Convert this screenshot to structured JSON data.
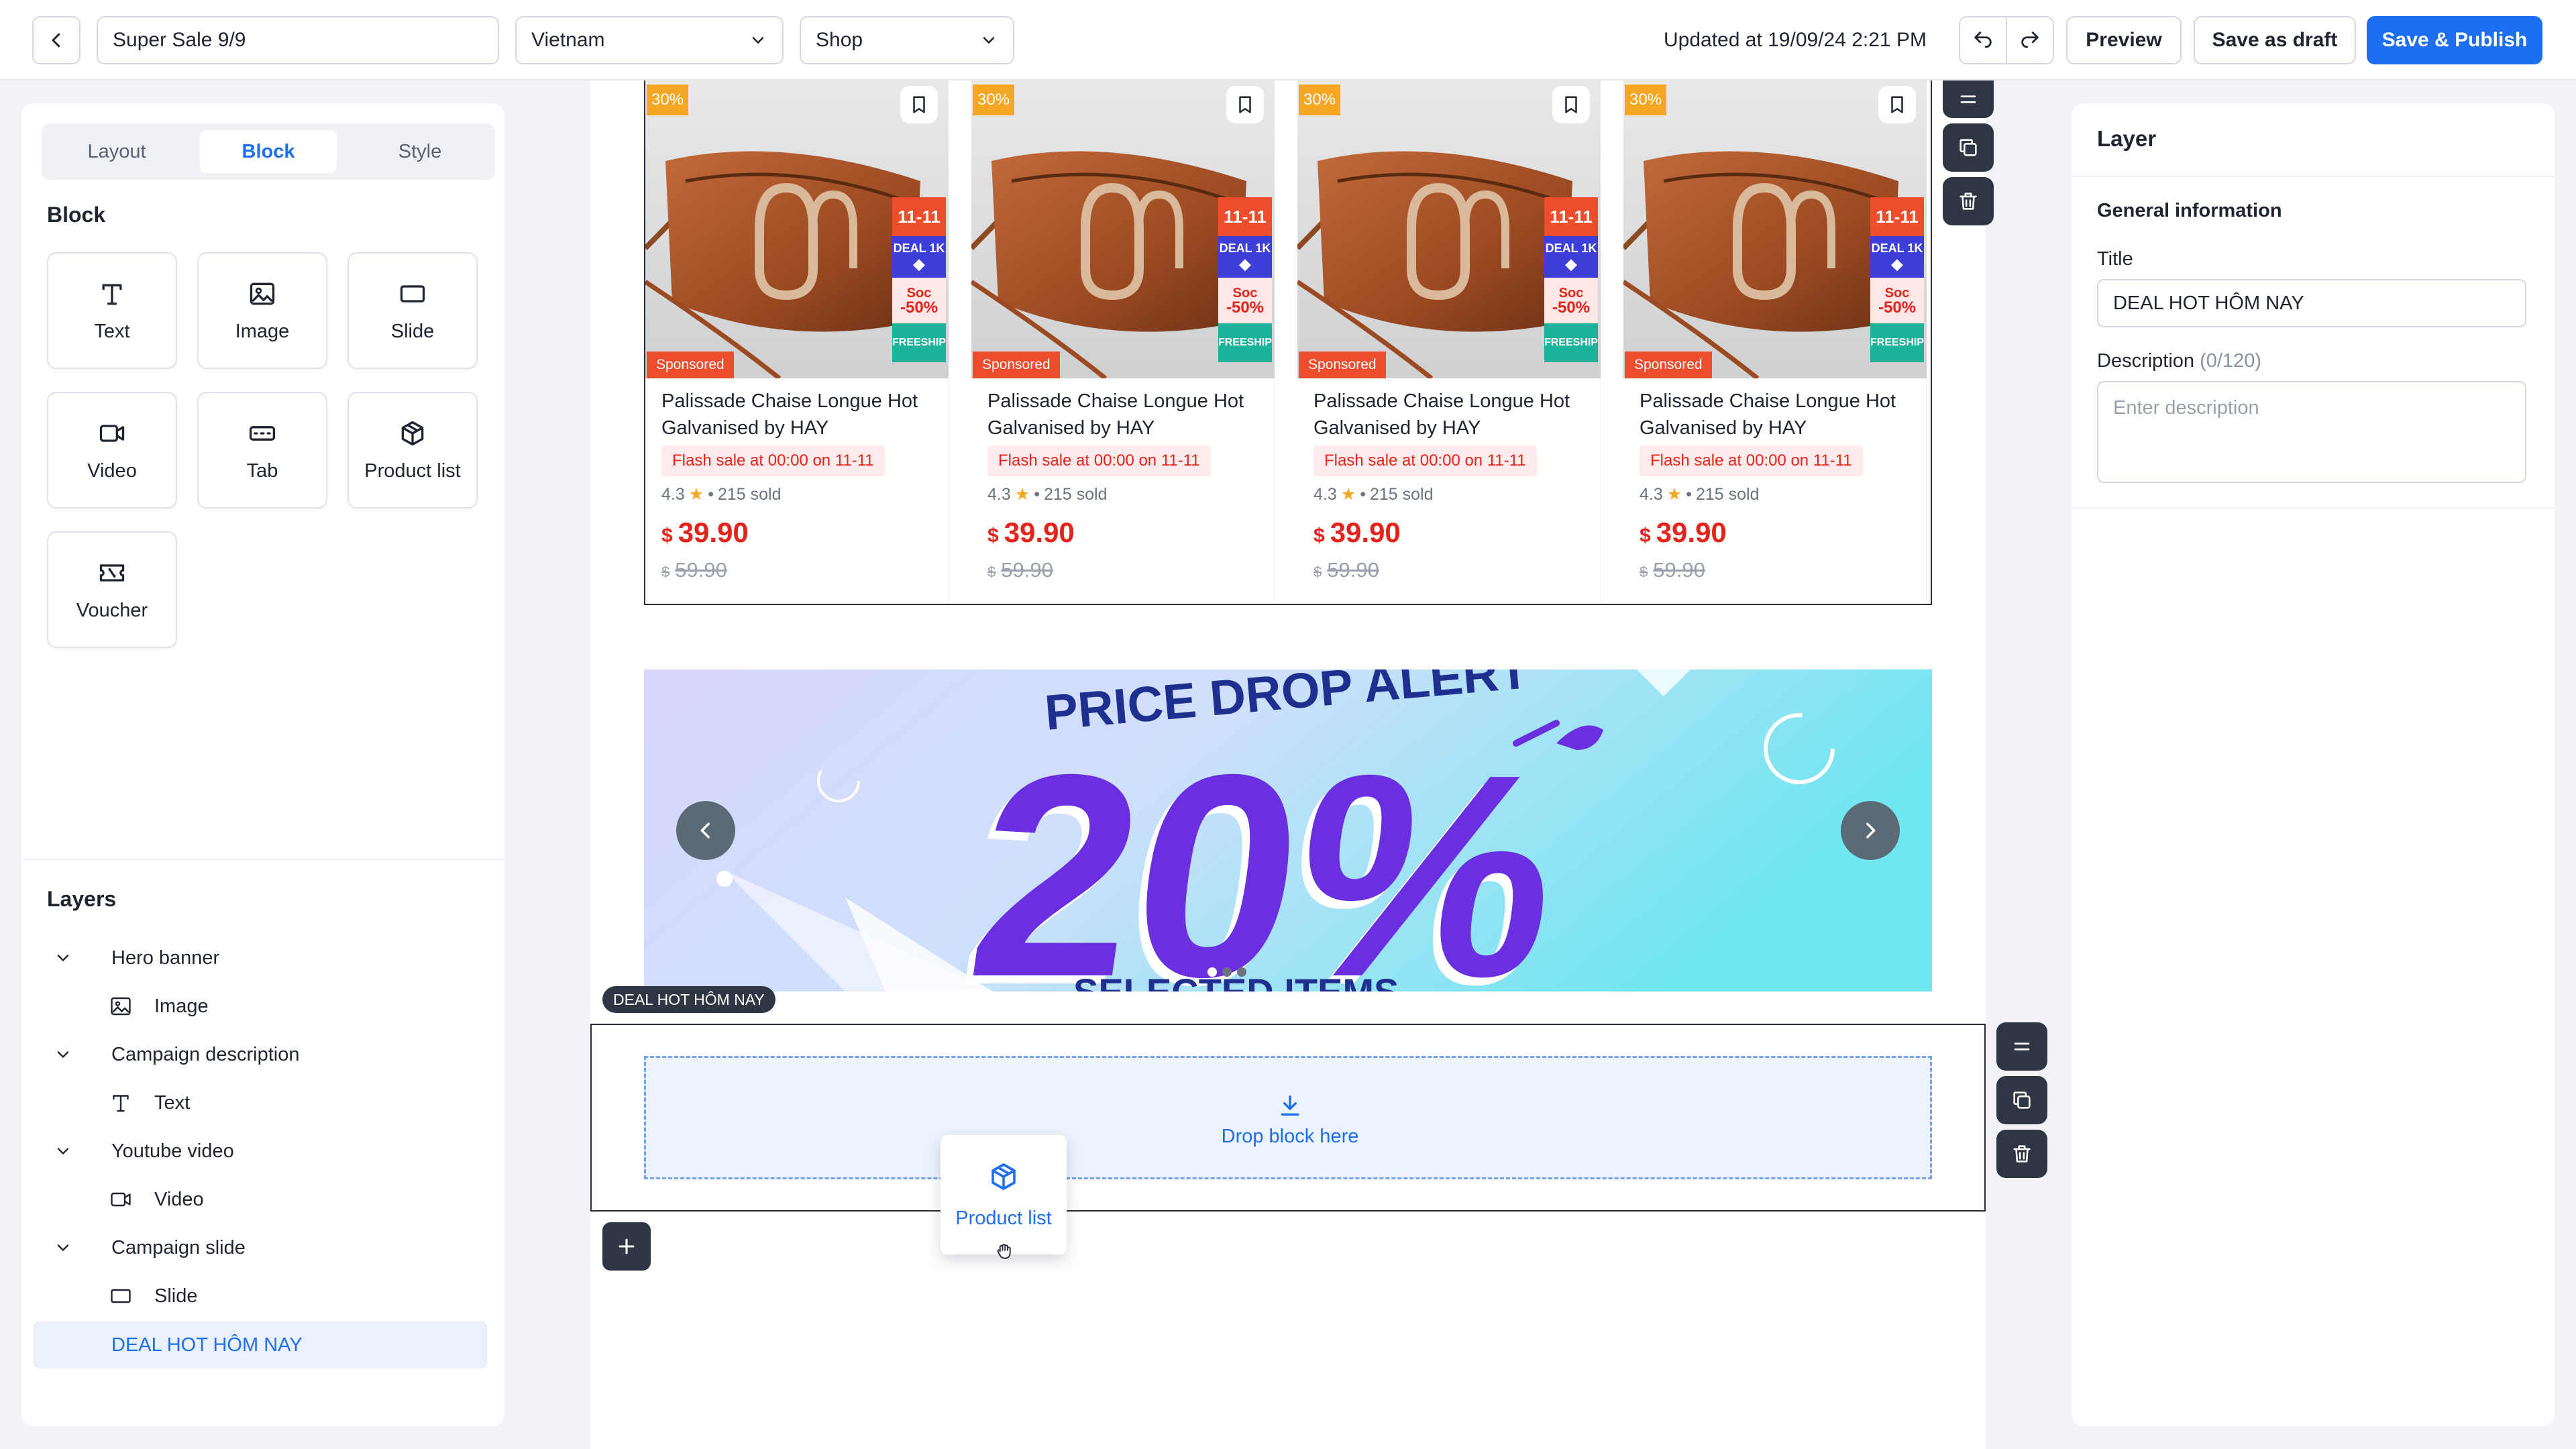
{
  "topbar": {
    "campaign_name": "Super Sale 9/9",
    "country": "Vietnam",
    "channel": "Shop",
    "updated": "Updated at 19/09/24 2:21 PM",
    "preview": "Preview",
    "save_draft": "Save as draft",
    "save_publish": "Save & Publish"
  },
  "left": {
    "tabs": [
      "Layout",
      "Block",
      "Style"
    ],
    "active_tab": "Block",
    "block_title": "Block",
    "blocks": [
      {
        "label": "Text",
        "icon": "text-icon"
      },
      {
        "label": "Image",
        "icon": "image-icon"
      },
      {
        "label": "Slide",
        "icon": "slide-icon"
      },
      {
        "label": "Video",
        "icon": "video-icon"
      },
      {
        "label": "Tab",
        "icon": "tab-icon"
      },
      {
        "label": "Product list",
        "icon": "box-icon"
      },
      {
        "label": "Voucher",
        "icon": "voucher-icon"
      }
    ],
    "layers_title": "Layers",
    "layers": [
      {
        "label": "Hero banner",
        "type": "parent"
      },
      {
        "label": "Image",
        "type": "child",
        "icon": "image-icon"
      },
      {
        "label": "Campaign description",
        "type": "parent"
      },
      {
        "label": "Text",
        "type": "child",
        "icon": "text-icon"
      },
      {
        "label": "Youtube video",
        "type": "parent"
      },
      {
        "label": "Video",
        "type": "child",
        "icon": "video-icon"
      },
      {
        "label": "Campaign slide",
        "type": "parent"
      },
      {
        "label": "Slide",
        "type": "child",
        "icon": "slide-icon"
      },
      {
        "label": "DEAL HOT HÔM NAY",
        "type": "selected"
      }
    ]
  },
  "products": [
    {
      "discount": "30%",
      "tag_sale": "11-11",
      "tag_deal": "DEAL 1K",
      "tag_soc": "Soc",
      "tag_pct": "-50%",
      "tag_free": "FREESHIP",
      "sponsored": "Sponsored",
      "name": "Palissade Chaise Longue Hot Galvanised by HAY",
      "flash": "Flash sale at 00:00 on 11-11",
      "rating": "4.3",
      "sold": "215 sold",
      "currency": "$",
      "price": "39.90",
      "old_price": "59.90"
    },
    {
      "discount": "30%",
      "tag_sale": "11-11",
      "tag_deal": "DEAL 1K",
      "tag_soc": "Soc",
      "tag_pct": "-50%",
      "tag_free": "FREESHIP",
      "sponsored": "Sponsored",
      "name": "Palissade Chaise Longue Hot Galvanised by HAY",
      "flash": "Flash sale at 00:00 on 11-11",
      "rating": "4.3",
      "sold": "215 sold",
      "currency": "$",
      "price": "39.90",
      "old_price": "59.90"
    },
    {
      "discount": "30%",
      "tag_sale": "11-11",
      "tag_deal": "DEAL 1K",
      "tag_soc": "Soc",
      "tag_pct": "-50%",
      "tag_free": "FREESHIP",
      "sponsored": "Sponsored",
      "name": "Palissade Chaise Longue Hot Galvanised by HAY",
      "flash": "Flash sale at 00:00 on 11-11",
      "rating": "4.3",
      "sold": "215 sold",
      "currency": "$",
      "price": "39.90",
      "old_price": "59.90"
    },
    {
      "discount": "30%",
      "tag_sale": "11-11",
      "tag_deal": "DEAL 1K",
      "tag_soc": "Soc",
      "tag_pct": "-50%",
      "tag_free": "FREESHIP",
      "sponsored": "Sponsored",
      "name": "Palissade Chaise Longue Hot Galvanised by HAY",
      "flash": "Flash sale at 00:00 on 11-11",
      "rating": "4.3",
      "sold": "215 sold",
      "currency": "$",
      "price": "39.90",
      "old_price": "59.90"
    }
  ],
  "banner": {
    "headline": "PRICE DROP ALERT",
    "big_text": "20%",
    "footer": "SELECTED ITEMS",
    "slide_count": 3,
    "active_slide": 1
  },
  "deal_section": {
    "label": "DEAL HOT HÔM NAY",
    "drop_text": "Drop block here",
    "dragging_block": "Product list"
  },
  "right": {
    "title": "Layer",
    "general": "General information",
    "title_label": "Title",
    "title_value": "DEAL HOT HÔM NAY",
    "desc_label": "Description",
    "desc_count": "(0/120)",
    "desc_placeholder": "Enter description"
  },
  "colors": {
    "accent": "#1d6ef0",
    "dark_tool": "#2f3643",
    "price_red": "#e5231b",
    "banner_purple": "#6a2fe0"
  }
}
